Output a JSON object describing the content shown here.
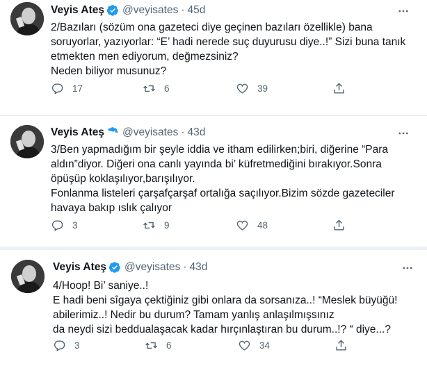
{
  "tweets": [
    {
      "name": "Veyis Ateş",
      "handle": "@veyisates",
      "separator": "·",
      "time": "45d",
      "lines": [
        "2/Bazıları (sözüm ona gazeteci diye geçinen bazıları özellikle) bana",
        "soruyorlar, yazıyorlar: “E’ hadi nerede suç duyurusu diye..!” Sizi buna tanık",
        "etmekten men ediyorum, değmezsiniz?",
        "Neden biliyor musunuz?"
      ],
      "replies": "17",
      "retweets": "6",
      "likes": "39"
    },
    {
      "name": "Veyis Ateş",
      "handle": "@veyisates",
      "separator": "·",
      "time": "43d",
      "lines": [
        "3/Ben yapmadığım bir şeyle iddia ve itham edilirken;biri, diğerine “Para",
        "aldın”diyor. Diğeri ona canlı yayında bi’ küfretmediğini bırakıyor.Sonra",
        "öpüşüp koklaşılıyor,barışılıyor.",
        "Fonlanma listeleri çarşafçarşaf ortalığa saçılıyor.Bizim sözde gazeteciler",
        "havaya bakıp ıslık çalıyor"
      ],
      "replies": "3",
      "retweets": "9",
      "likes": "48"
    },
    {
      "name": "Veyis Ateş",
      "handle": "@veyisates",
      "separator": "·",
      "time": "43d",
      "lines": [
        "4/Hoop! Bi’ saniye..!",
        "E hadi beni sîgaya çektiğiniz gibi onlara da sorsanıza..! “Meslek büyüğü!",
        "abilerimiz..! Nedir bu durum? Tamam yanlış anlaşılmışsınız",
        "da neydi sizi beddualaşacak kadar hırçınlaştıran bu durum..!? “ diye...?"
      ],
      "replies": "3",
      "retweets": "6",
      "likes": "34"
    }
  ],
  "colors": {
    "verified": "#1d9bf0",
    "muted": "#536471",
    "text": "#0f1419"
  }
}
